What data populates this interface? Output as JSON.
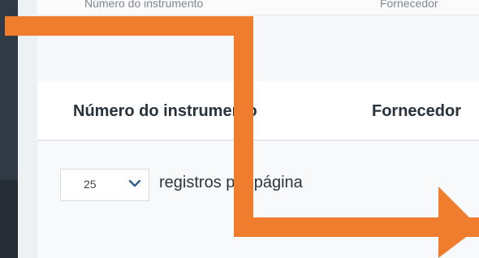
{
  "top_strip": {
    "left_text": "Número do instrumento",
    "right_text": "Fornecedor"
  },
  "table": {
    "headers": [
      "Número do instrumento",
      "Fornecedor"
    ]
  },
  "pagination": {
    "page_size": "25",
    "label": "registros por página"
  },
  "icons": {
    "dropdown": "chevron-down-icon",
    "overlay": "orange-arrow-icon"
  },
  "colors": {
    "accent": "#ef7d2d",
    "sidebar": "#2f3a45",
    "background": "#eef1f4",
    "card": "#ffffff",
    "text": "#27323d"
  }
}
